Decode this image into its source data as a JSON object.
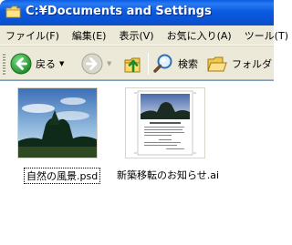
{
  "window": {
    "title": "C:¥Documents and Settings"
  },
  "menu": [
    {
      "label": "ファイル(F)"
    },
    {
      "label": "編集(E)"
    },
    {
      "label": "表示(V)"
    },
    {
      "label": "お気に入り(A)"
    },
    {
      "label": "ツール(T)"
    }
  ],
  "toolbar": {
    "back_label": "戻る",
    "search_label": "検索",
    "folders_label": "フォルダ"
  },
  "files": [
    {
      "name": "自然の風景.psd",
      "selected": true
    },
    {
      "name": "新築移転のお知らせ.ai",
      "selected": false
    }
  ],
  "colors": {
    "titlebar": "#0a5ee6",
    "chrome": "#ece9d8",
    "back_arrow": "#2fa63b"
  }
}
